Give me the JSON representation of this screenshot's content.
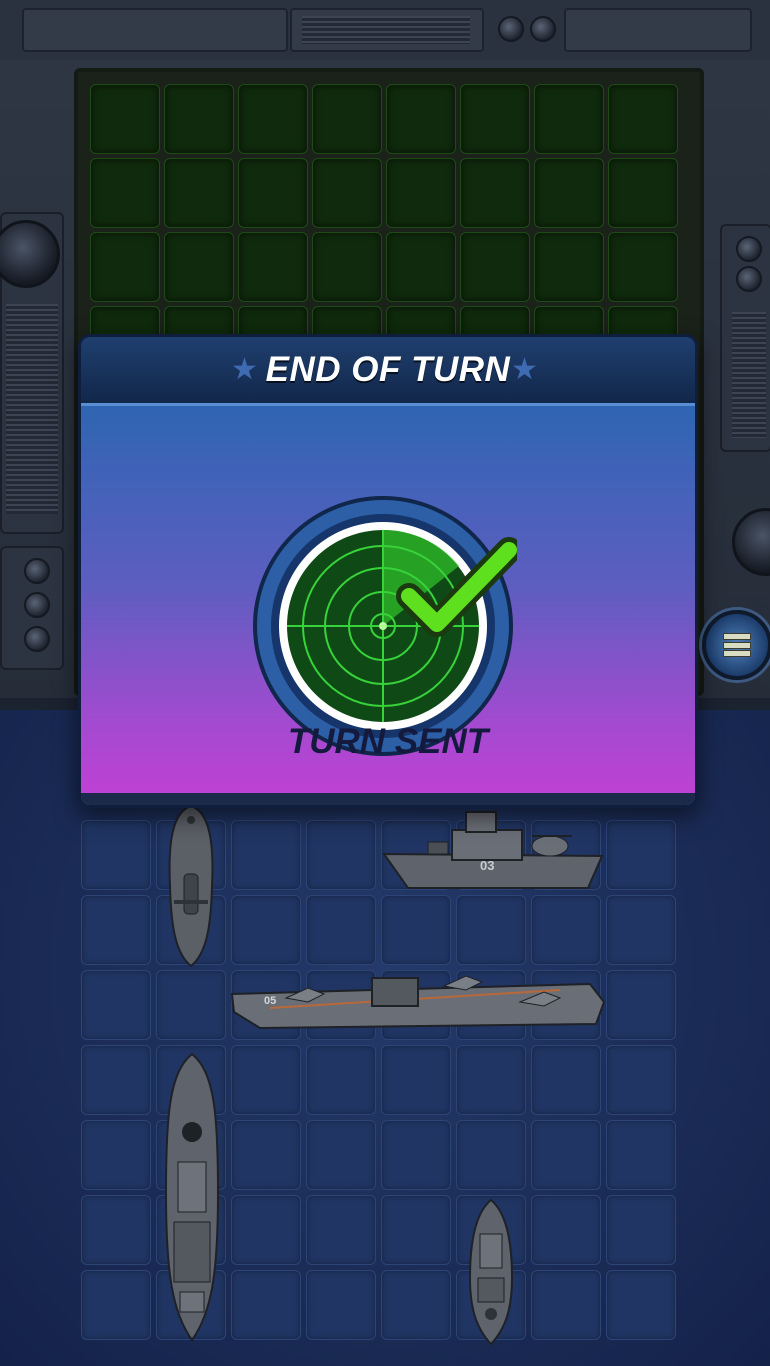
{
  "dialog": {
    "title": "END OF TURN",
    "status": "TURN SENT",
    "icon": "radar-checkmark-icon"
  },
  "menu": {
    "icon": "hamburger-menu-icon"
  },
  "ships": {
    "top_ship_number": "03",
    "carrier_number": "05"
  },
  "colors": {
    "radar_green": "#1f4a18",
    "ocean_blue": "#203563",
    "dialog_gradient_top": "#2f65b3",
    "dialog_gradient_bottom": "#c240d4",
    "checkmark": "#5fe01f"
  }
}
